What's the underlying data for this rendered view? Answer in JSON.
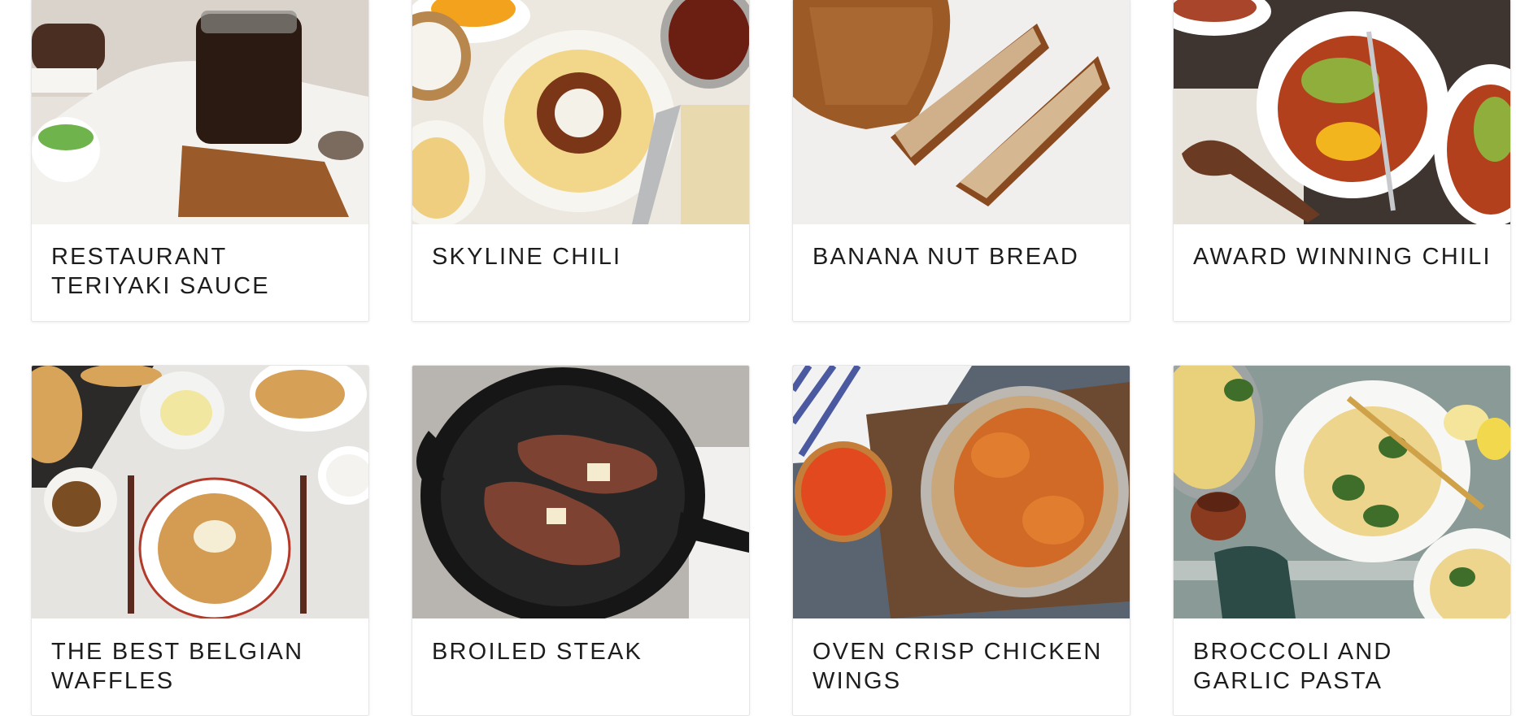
{
  "recipes": [
    {
      "title": "RESTAURANT TERIYAKI SAUCE",
      "image": "teriyaki-sauce-jar"
    },
    {
      "title": "SKYLINE CHILI",
      "image": "skyline-chili-spaghetti"
    },
    {
      "title": "BANANA NUT BREAD",
      "image": "banana-nut-bread-slices"
    },
    {
      "title": "AWARD WINNING CHILI",
      "image": "chili-bowls-avocado"
    },
    {
      "title": "THE BEST BELGIAN WAFFLES",
      "image": "belgian-waffles-table"
    },
    {
      "title": "BROILED STEAK",
      "image": "steak-cast-iron-skillet"
    },
    {
      "title": "OVEN CRISP CHICKEN WINGS",
      "image": "chicken-wings-sauce"
    },
    {
      "title": "BROCCOLI AND GARLIC PASTA",
      "image": "broccoli-pasta-plates"
    }
  ]
}
